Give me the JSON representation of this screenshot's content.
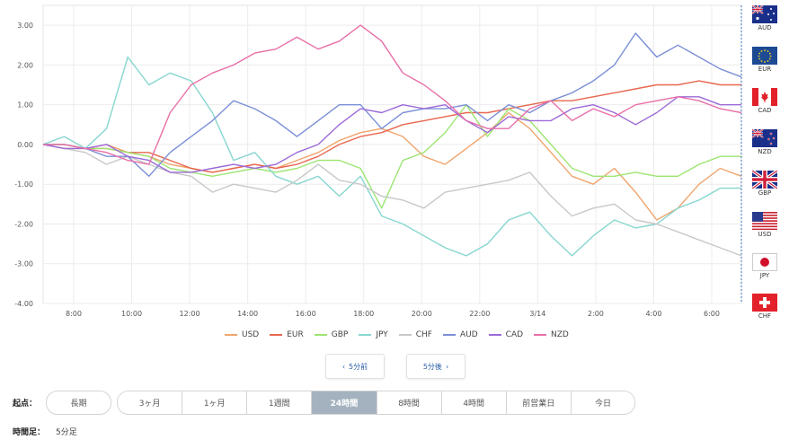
{
  "chart_data": {
    "type": "line",
    "y_ticks": [
      "3.00",
      "2.00",
      "1.00",
      "0.00",
      "-1.00",
      "-2.00",
      "-3.00",
      "-4.00"
    ],
    "y_values": [
      3,
      2,
      1,
      0,
      -1,
      -2,
      -3,
      -4
    ],
    "ylim": [
      -4,
      3.5
    ],
    "x_ticks": [
      "8:00",
      "10:00",
      "12:00",
      "14:00",
      "16:00",
      "18:00",
      "20:00",
      "22:00",
      "3/14",
      "2:00",
      "4:00",
      "6:00"
    ],
    "grid": true,
    "legend_position": "bottom",
    "series": [
      {
        "name": "USD",
        "color": "#f0a46b",
        "values": [
          0,
          -0.1,
          -0.1,
          0,
          -0.2,
          -0.3,
          -0.5,
          -0.6,
          -0.7,
          -0.6,
          -0.5,
          -0.6,
          -0.4,
          -0.2,
          0.1,
          0.3,
          0.4,
          0.2,
          -0.3,
          -0.5,
          -0.1,
          0.3,
          0.8,
          0.4,
          -0.2,
          -0.8,
          -1.0,
          -0.6,
          -1.2,
          -1.9,
          -1.6,
          -1.0,
          -0.6,
          -0.8
        ]
      },
      {
        "name": "EUR",
        "color": "#e8674f",
        "values": [
          0,
          0,
          -0.1,
          -0.1,
          -0.2,
          -0.2,
          -0.4,
          -0.6,
          -0.7,
          -0.6,
          -0.5,
          -0.6,
          -0.5,
          -0.3,
          0,
          0.2,
          0.3,
          0.5,
          0.6,
          0.7,
          0.8,
          0.8,
          0.9,
          1.0,
          1.1,
          1.1,
          1.2,
          1.3,
          1.4,
          1.5,
          1.5,
          1.6,
          1.5,
          1.5
        ]
      },
      {
        "name": "GBP",
        "color": "#9de572",
        "values": [
          0,
          0,
          -0.1,
          -0.1,
          -0.2,
          -0.3,
          -0.6,
          -0.7,
          -0.8,
          -0.7,
          -0.6,
          -0.7,
          -0.6,
          -0.4,
          -0.4,
          -0.6,
          -1.6,
          -0.4,
          -0.2,
          0.3,
          1.0,
          0.2,
          0.9,
          0.6,
          0.0,
          -0.6,
          -0.8,
          -0.8,
          -0.7,
          -0.8,
          -0.8,
          -0.5,
          -0.3,
          -0.3
        ]
      },
      {
        "name": "JPY",
        "color": "#86d6cf",
        "values": [
          0,
          0.2,
          -0.1,
          0.4,
          2.2,
          1.5,
          1.8,
          1.6,
          0.8,
          -0.4,
          -0.2,
          -0.8,
          -1.0,
          -0.8,
          -1.3,
          -0.8,
          -1.8,
          -2.0,
          -2.3,
          -2.6,
          -2.8,
          -2.5,
          -1.9,
          -1.7,
          -2.3,
          -2.8,
          -2.3,
          -1.9,
          -2.1,
          -2.0,
          -1.6,
          -1.4,
          -1.1,
          -1.1
        ]
      },
      {
        "name": "CHF",
        "color": "#c8c8c8",
        "values": [
          0,
          -0.1,
          -0.2,
          -0.5,
          -0.3,
          -0.5,
          -0.7,
          -0.8,
          -1.2,
          -1.0,
          -1.1,
          -1.2,
          -0.9,
          -0.5,
          -0.9,
          -1.0,
          -1.3,
          -1.4,
          -1.6,
          -1.2,
          -1.1,
          -1.0,
          -0.9,
          -0.7,
          -1.3,
          -1.8,
          -1.6,
          -1.5,
          -1.9,
          -2.0,
          -2.2,
          -2.4,
          -2.6,
          -2.8
        ]
      },
      {
        "name": "AUD",
        "color": "#7b8fd6",
        "values": [
          0,
          0,
          -0.1,
          -0.3,
          -0.3,
          -0.8,
          -0.2,
          0.2,
          0.6,
          1.1,
          0.9,
          0.6,
          0.2,
          0.6,
          1.0,
          1.0,
          0.4,
          0.8,
          0.9,
          0.9,
          1.0,
          0.6,
          1.0,
          0.8,
          1.1,
          1.3,
          1.6,
          2.0,
          2.8,
          2.2,
          2.5,
          2.2,
          1.9,
          1.7
        ]
      },
      {
        "name": "CAD",
        "color": "#9c6ad8",
        "values": [
          0,
          -0.1,
          -0.1,
          0,
          -0.3,
          -0.4,
          -0.7,
          -0.7,
          -0.6,
          -0.5,
          -0.6,
          -0.5,
          -0.2,
          0,
          0.5,
          0.9,
          0.8,
          1.0,
          0.9,
          1.0,
          0.6,
          0.3,
          0.7,
          0.6,
          0.6,
          0.9,
          1.0,
          0.8,
          0.5,
          0.8,
          1.2,
          1.2,
          1.0,
          1.0
        ]
      },
      {
        "name": "NZD",
        "color": "#e86fa8",
        "values": [
          0,
          0,
          -0.1,
          -0.2,
          -0.4,
          -0.5,
          0.8,
          1.5,
          1.8,
          2.0,
          2.3,
          2.4,
          2.7,
          2.4,
          2.6,
          3.0,
          2.6,
          1.8,
          1.5,
          1.1,
          0.6,
          0.4,
          0.4,
          0.9,
          1.1,
          0.6,
          0.9,
          0.7,
          1.0,
          1.1,
          1.2,
          1.1,
          0.9,
          0.8
        ]
      }
    ]
  },
  "flags": [
    {
      "code": "AUD",
      "icon": "australia-flag-icon"
    },
    {
      "code": "EUR",
      "icon": "eu-flag-icon"
    },
    {
      "code": "CAD",
      "icon": "canada-flag-icon"
    },
    {
      "code": "NZD",
      "icon": "new-zealand-flag-icon"
    },
    {
      "code": "GBP",
      "icon": "uk-flag-icon"
    },
    {
      "code": "USD",
      "icon": "usa-flag-icon"
    },
    {
      "code": "JPY",
      "icon": "japan-flag-icon"
    },
    {
      "code": "CHF",
      "icon": "switzerland-flag-icon"
    }
  ],
  "nav": {
    "prev": "5分前",
    "next": "5分後"
  },
  "start_label": "起点：",
  "long_term": "長期",
  "periods": [
    "3ヶ月",
    "1ヶ月",
    "1週間",
    "24時間",
    "8時間",
    "4時間",
    "前営業日",
    "今日"
  ],
  "active_period": "24時間",
  "timeframe_label": "時間足：",
  "timeframe_value": "5分足"
}
